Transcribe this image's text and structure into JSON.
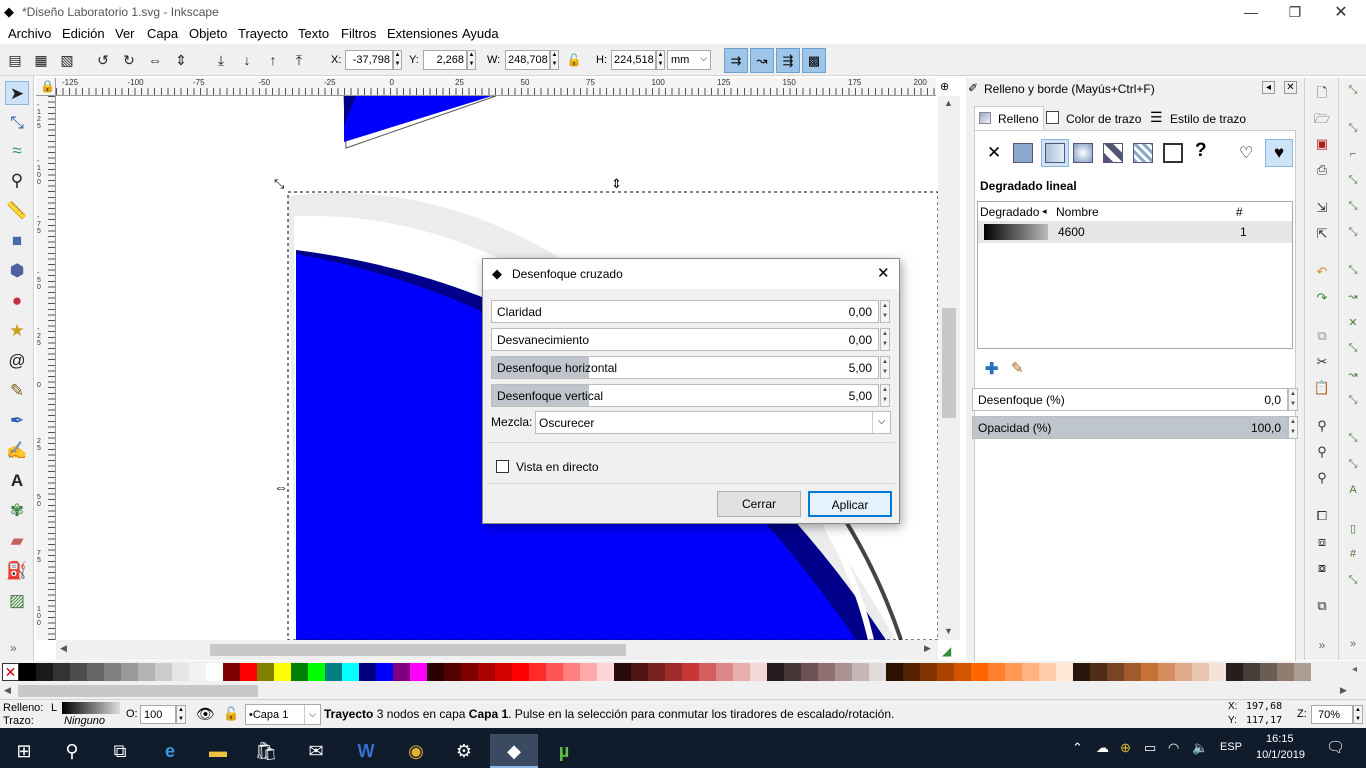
{
  "window": {
    "title": "*Diseño Laboratorio 1.svg - Inkscape",
    "minimize_glyph": "—",
    "maximize_glyph": "❐",
    "close_glyph": "✕"
  },
  "menu": [
    "Archivo",
    "Edición",
    "Ver",
    "Capa",
    "Objeto",
    "Trayecto",
    "Texto",
    "Filtros",
    "Extensiones",
    "Ayuda"
  ],
  "toolbar": {
    "x_label": "X:",
    "x_value": "-37,798",
    "y_label": "Y:",
    "y_value": "2,268",
    "w_label": "W:",
    "w_value": "248,708",
    "h_label": "H:",
    "h_value": "224,518",
    "unit": "mm"
  },
  "ruler": {
    "h_ticks": [
      "-125",
      "-100",
      "-75",
      "-50",
      "-25",
      "0",
      "25",
      "50",
      "75",
      "100",
      "125",
      "150",
      "175",
      "200"
    ],
    "v_ticks": [
      "-125",
      "-100",
      "-75",
      "-50",
      "-25",
      "0",
      "25",
      "50",
      "75",
      "100"
    ]
  },
  "dialog": {
    "title": "Desenfoque cruzado",
    "fields": [
      {
        "label": "Claridad",
        "value": "0,00",
        "fill": 0
      },
      {
        "label": "Desvanecimiento",
        "value": "0,00",
        "fill": 0
      },
      {
        "label": "Desenfoque horizontal",
        "value": "5,00",
        "fill": 0.25
      },
      {
        "label": "Desenfoque vertical",
        "value": "5,00",
        "fill": 0.25
      }
    ],
    "blend_label": "Mezcla:",
    "blend_value": "Oscurecer",
    "live_preview_label": "Vista en directo",
    "live_preview_checked": false,
    "close_button": "Cerrar",
    "apply_button": "Aplicar"
  },
  "fill_stroke_panel": {
    "title": "Relleno y borde (Mayús+Ctrl+F)",
    "tabs": [
      "Relleno",
      "Color de trazo",
      "Estilo de trazo"
    ],
    "active_tab": 0,
    "paint_type_label": "Degradado lineal",
    "gradient_table": {
      "headers": [
        "Degradado",
        "Nombre",
        "#"
      ],
      "rows": [
        {
          "name": "4600",
          "count": "1"
        }
      ]
    },
    "blur_label": "Desenfoque (%)",
    "blur_value": "0,0",
    "blur_level": 0,
    "opacity_label": "Opacidad (%)",
    "opacity_value": "100,0",
    "opacity_level": 1.0
  },
  "statusbar": {
    "fill_label": "Relleno:",
    "fill_type": "L",
    "stroke_label": "Trazo:",
    "stroke_value": "Ninguno",
    "opacity_label": "O:",
    "opacity_value": "100",
    "layer": "•Capa 1",
    "message_bold1": "Trayecto",
    "message_part1": " 3 nodos en capa ",
    "message_bold2": "Capa 1",
    "message_part2": ". Pulse en la selección para conmutar los tiradores de escalado/rotación.",
    "cursor_x_label": "X:",
    "cursor_x": "197,68",
    "cursor_y_label": "Y:",
    "cursor_y": "117,17",
    "zoom_label": "Z:",
    "zoom_value": "70%"
  },
  "taskbar": {
    "language": "ESP",
    "time": "16:15",
    "date": "10/1/2019"
  },
  "colors": {
    "accent_blue": "#0000ff",
    "dark_blue": "#00008b",
    "taskbar": "#101c2c",
    "selected_button": "#9ec4e8"
  },
  "palette": [
    "#000000",
    "#1a1a1a",
    "#333333",
    "#4d4d4d",
    "#666666",
    "#808080",
    "#999999",
    "#b3b3b3",
    "#cccccc",
    "#e6e6e6",
    "#f2f2f2",
    "#ffffff",
    "#800000",
    "#ff0000",
    "#808000",
    "#ffff00",
    "#008000",
    "#00ff00",
    "#008080",
    "#00ffff",
    "#000080",
    "#0000ff",
    "#800080",
    "#ff00ff",
    "#2b0000",
    "#550000",
    "#800000",
    "#aa0000",
    "#d40000",
    "#ff0000",
    "#ff2a2a",
    "#ff5555",
    "#ff8080",
    "#ffaaaa",
    "#ffd5d5",
    "#280b0b",
    "#501616",
    "#782121",
    "#a02c2c",
    "#c83737",
    "#d35f5f",
    "#de8787",
    "#e9afaf",
    "#f4d7d7",
    "#241c1c",
    "#483737",
    "#6c5353",
    "#916f6f",
    "#ac9393",
    "#c8b7b7",
    "#e3dbdb",
    "#2b1100",
    "#552200",
    "#803300",
    "#aa4400",
    "#d45500",
    "#ff6600",
    "#ff7f2a",
    "#ff9955",
    "#ffb380",
    "#ffccaa",
    "#ffe6d5",
    "#28170b",
    "#502d16",
    "#784421",
    "#a05a2c",
    "#c87137",
    "#d38d5f",
    "#deaa87",
    "#e9c6af",
    "#f4e3d7",
    "#241f1c",
    "#483e37",
    "#6c5d53",
    "#917c6f",
    "#ac9d93"
  ]
}
